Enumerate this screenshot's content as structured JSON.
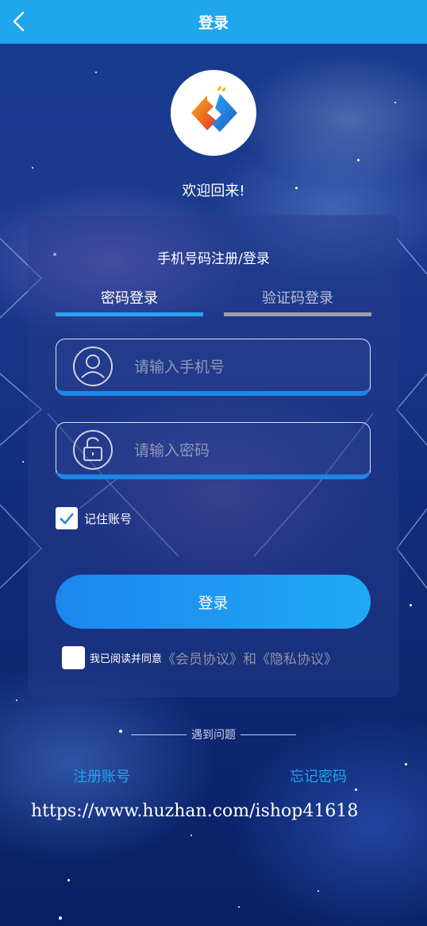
{
  "header": {
    "title": "登录",
    "back_icon": "chevron-left-icon"
  },
  "logo": {
    "icon": "brand-logo-icon"
  },
  "welcome": "欢迎回来!",
  "card": {
    "title": "手机号码注册/登录",
    "tabs": [
      {
        "label": "密码登录",
        "active": true
      },
      {
        "label": "验证码登录",
        "active": false
      }
    ],
    "phone": {
      "placeholder": "请输入手机号",
      "value": "",
      "icon": "user-icon"
    },
    "password": {
      "placeholder": "请输入密码",
      "value": "",
      "icon": "unlock-icon"
    },
    "remember": {
      "label": "记住账号",
      "checked": true
    },
    "login_button": "登录",
    "agreement": {
      "checked": false,
      "prefix": "我已阅读并同意",
      "member_link": "《会员协议》",
      "and": "和",
      "privacy_link": "《隐私协议》"
    }
  },
  "footer": {
    "problem": "遇到问题",
    "register": "注册账号",
    "forgot": "忘记密码",
    "watermark": "https://www.huzhan.com/ishop41618"
  },
  "colors": {
    "header": "#1fa6ec",
    "accent": "#23a5f0",
    "link": "#1fa6ec",
    "inactive_tab": "#9a9ea8"
  }
}
